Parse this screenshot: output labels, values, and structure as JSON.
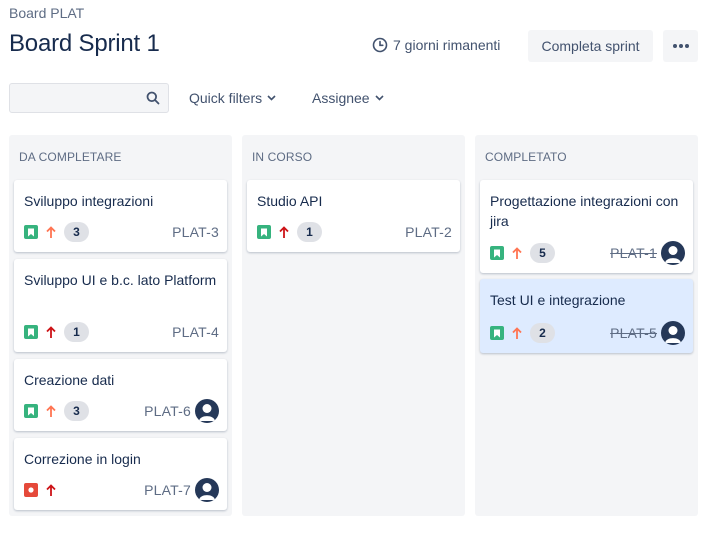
{
  "header": {
    "breadcrumb": "Board PLAT",
    "title": "Board Sprint 1",
    "remaining": "7 giorni rimanenti",
    "complete_label": "Completa sprint",
    "more_icon": "more-icon",
    "clock_icon": "clock-icon"
  },
  "toolbar": {
    "search_value": "",
    "search_placeholder": "",
    "search_icon": "search-icon",
    "quick_filters_label": "Quick filters",
    "assignee_label": "Assignee"
  },
  "colors": {
    "story": "#36b37e",
    "bug": "#e5493a",
    "priority_high": "#ff7452",
    "priority_highest": "#cd1317",
    "selected_card": "#deebff",
    "column_bg": "#f4f5f7",
    "avatar": "#253858"
  },
  "columns": [
    {
      "title": "DA COMPLETARE",
      "cards": [
        {
          "title": "Sviluppo integrazioni",
          "type": "story",
          "priority": "high",
          "points": "3",
          "key": "PLAT-3",
          "avatar": false,
          "done": false
        },
        {
          "title": "Sviluppo UI e b.c. lato Platform",
          "type": "story",
          "priority": "highest",
          "points": "1",
          "key": "PLAT-4",
          "avatar": false,
          "done": false
        },
        {
          "title": "Creazione dati",
          "type": "story",
          "priority": "high",
          "points": "3",
          "key": "PLAT-6",
          "avatar": true,
          "done": false
        },
        {
          "title": "Correzione in login",
          "type": "bug",
          "priority": "highest",
          "points": "",
          "key": "PLAT-7",
          "avatar": true,
          "done": false
        }
      ]
    },
    {
      "title": "IN CORSO",
      "cards": [
        {
          "title": "Studio API",
          "type": "story",
          "priority": "highest",
          "points": "1",
          "key": "PLAT-2",
          "avatar": false,
          "done": false
        }
      ]
    },
    {
      "title": "COMPLETATO",
      "cards": [
        {
          "title": "Progettazione integrazioni con jira",
          "type": "story",
          "priority": "high",
          "points": "5",
          "key": "PLAT-1",
          "avatar": true,
          "done": true
        },
        {
          "title": "Test UI e integrazione",
          "type": "story",
          "priority": "high",
          "points": "2",
          "key": "PLAT-5",
          "avatar": true,
          "done": true,
          "selected": true
        }
      ]
    }
  ]
}
